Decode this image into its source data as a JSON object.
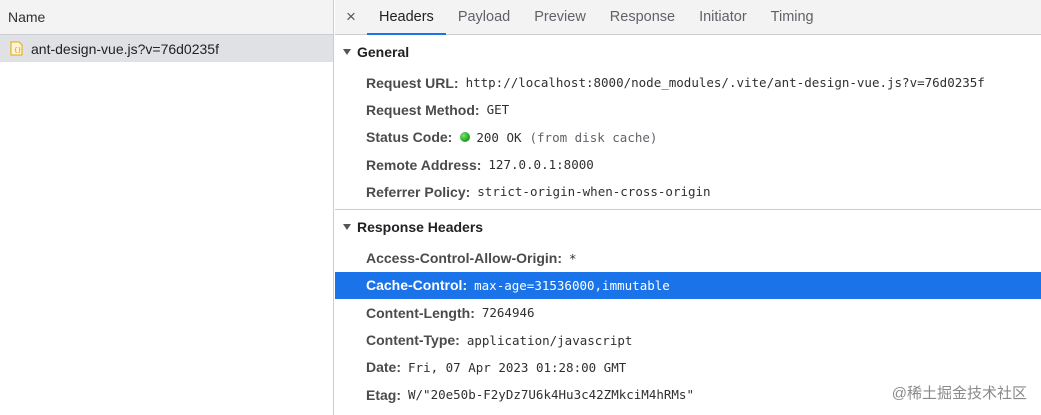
{
  "left_panel": {
    "header": "Name",
    "request": {
      "name": "ant-design-vue.js?v=76d0235f",
      "icon": "js-file-icon"
    }
  },
  "tabs": {
    "close": "×",
    "items": [
      "Headers",
      "Payload",
      "Preview",
      "Response",
      "Initiator",
      "Timing"
    ],
    "active": "Headers"
  },
  "general": {
    "title": "General",
    "request_url": {
      "key": "Request URL:",
      "value": "http://localhost:8000/node_modules/.vite/ant-design-vue.js?v=76d0235f"
    },
    "request_method": {
      "key": "Request Method:",
      "value": "GET"
    },
    "status_code": {
      "key": "Status Code:",
      "value": "200 OK",
      "note": "(from disk cache)",
      "status_color": "#1fa81f"
    },
    "remote_address": {
      "key": "Remote Address:",
      "value": "127.0.0.1:8000"
    },
    "referrer_policy": {
      "key": "Referrer Policy:",
      "value": "strict-origin-when-cross-origin"
    }
  },
  "response_headers": {
    "title": "Response Headers",
    "access_control": {
      "key": "Access-Control-Allow-Origin:",
      "value": "*"
    },
    "cache_control": {
      "key": "Cache-Control:",
      "value": "max-age=31536000,immutable"
    },
    "content_length": {
      "key": "Content-Length:",
      "value": "7264946"
    },
    "content_type": {
      "key": "Content-Type:",
      "value": "application/javascript"
    },
    "date": {
      "key": "Date:",
      "value": "Fri, 07 Apr 2023 01:28:00 GMT"
    },
    "etag": {
      "key": "Etag:",
      "value": "W/\"20e50b-F2yDz7U6k4Hu3c42ZMkciM4hRMs\""
    }
  },
  "watermark": "@稀土掘金技术社区",
  "colors": {
    "accent": "#1a73e8",
    "selected_row": "#dfe1e5"
  }
}
